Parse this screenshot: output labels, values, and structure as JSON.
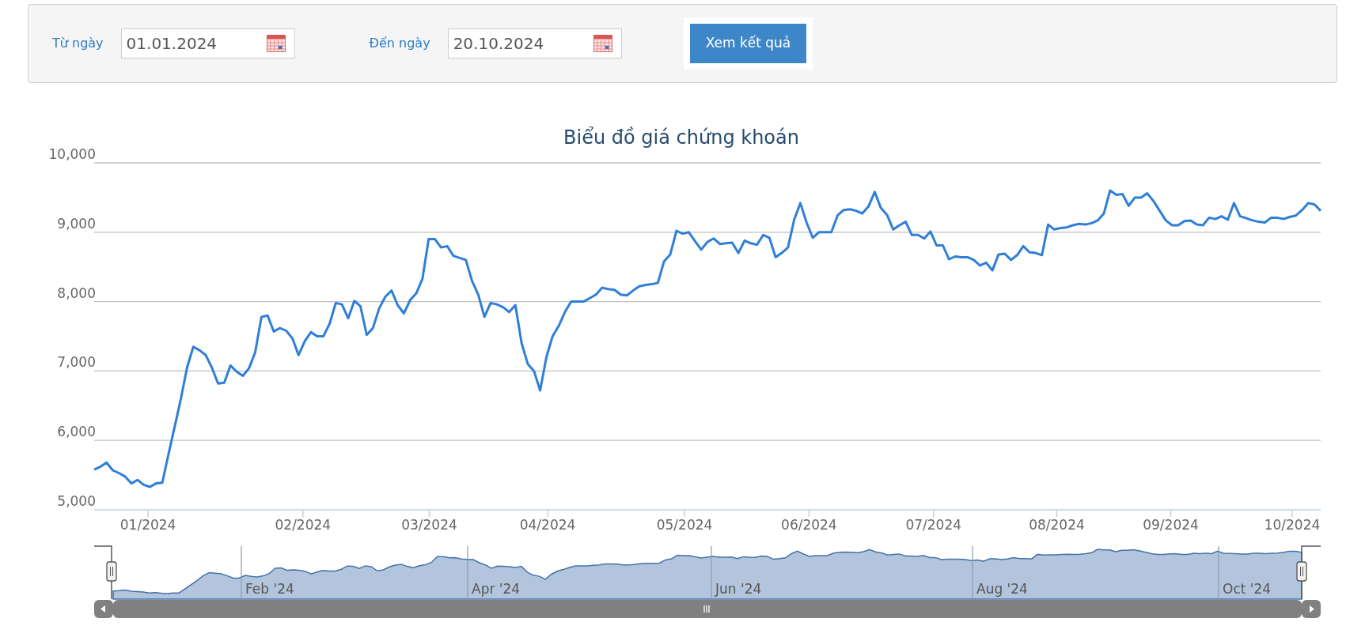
{
  "filter": {
    "from_label": "Từ ngày",
    "from_value": "01.01.2024",
    "to_label": "Đến ngày",
    "to_value": "20.10.2024",
    "submit_label": "Xem kết quả"
  },
  "chart": {
    "chart_data": {
      "type": "line",
      "title": "Biểu đồ giá chứng khoán",
      "values": [
        5580,
        5620,
        5680,
        5570,
        5530,
        5480,
        5380,
        5430,
        5360,
        5330,
        5380,
        5390,
        5800,
        6200,
        6600,
        7050,
        7350,
        7300,
        7230,
        7050,
        6820,
        6830,
        7080,
        6990,
        6930,
        7040,
        7270,
        7780,
        7800,
        7570,
        7620,
        7580,
        7470,
        7230,
        7430,
        7560,
        7500,
        7500,
        7680,
        7980,
        7960,
        7760,
        8010,
        7930,
        7520,
        7620,
        7900,
        8070,
        8160,
        7950,
        7830,
        8020,
        8120,
        8330,
        8900,
        8900,
        8780,
        8800,
        8660,
        8630,
        8600,
        8300,
        8100,
        7780,
        7980,
        7960,
        7920,
        7850,
        7950,
        7400,
        7100,
        7000,
        6720,
        7200,
        7500,
        7650,
        7850,
        8000,
        8000,
        8000,
        8050,
        8100,
        8200,
        8180,
        8170,
        8100,
        8090,
        8160,
        8220,
        8240,
        8250,
        8270,
        8580,
        8680,
        9020,
        8980,
        9000,
        8870,
        8750,
        8860,
        8910,
        8830,
        8840,
        8850,
        8700,
        8880,
        8840,
        8820,
        8960,
        8920,
        8640,
        8700,
        8780,
        9180,
        9420,
        9140,
        8920,
        9000,
        9000,
        9000,
        9240,
        9320,
        9330,
        9310,
        9270,
        9370,
        9580,
        9350,
        9250,
        9040,
        9100,
        9150,
        8960,
        8960,
        8910,
        9010,
        8810,
        8810,
        8610,
        8650,
        8640,
        8640,
        8600,
        8520,
        8560,
        8450,
        8680,
        8690,
        8600,
        8670,
        8800,
        8710,
        8700,
        8670,
        9110,
        9040,
        9060,
        9070,
        9100,
        9120,
        9110,
        9130,
        9170,
        9270,
        9600,
        9540,
        9550,
        9380,
        9500,
        9500,
        9560,
        9450,
        9310,
        9170,
        9100,
        9100,
        9160,
        9170,
        9110,
        9100,
        9210,
        9190,
        9230,
        9180,
        9420,
        9230,
        9200,
        9170,
        9150,
        9140,
        9210,
        9210,
        9190,
        9220,
        9240,
        9320,
        9420,
        9400,
        9310
      ],
      "ylim": [
        5000,
        10000
      ],
      "yticks": [
        {
          "value": 5000,
          "label": "5,000"
        },
        {
          "value": 6000,
          "label": "6,000"
        },
        {
          "value": 7000,
          "label": "7,000"
        },
        {
          "value": 8000,
          "label": "8,000"
        },
        {
          "value": 9000,
          "label": "9,000"
        },
        {
          "value": 10000,
          "label": "10,000"
        }
      ],
      "grid": true
    },
    "x_labels": [
      "01/2024",
      "02/2024",
      "03/2024",
      "04/2024",
      "05/2024",
      "06/2024",
      "07/2024",
      "08/2024",
      "09/2024",
      "10/2024"
    ],
    "navigator": {
      "labels": [
        "Feb '24",
        "Apr '24",
        "Jun '24",
        "Aug '24",
        "Oct '24"
      ]
    }
  }
}
